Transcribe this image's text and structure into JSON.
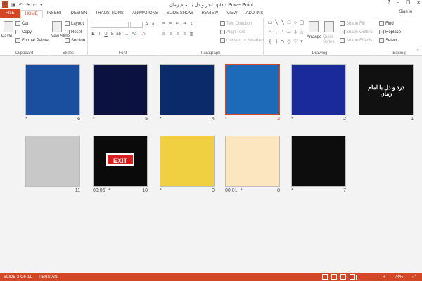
{
  "titlebar": {
    "title": "اندر و دل با امام زمان.pptx - PowerPoint",
    "app_logo": "P",
    "window_buttons": [
      "?",
      "–",
      "❐",
      "✕"
    ]
  },
  "tabs": [
    "FILE",
    "HOME",
    "INSERT",
    "DESIGN",
    "TRANSITIONS",
    "ANIMATIONS",
    "SLIDE SHOW",
    "REVIEW",
    "VIEW",
    "ADD-INS"
  ],
  "active_tab": "HOME",
  "signin": "Sign in",
  "ribbon": {
    "clipboard": {
      "label": "Clipboard",
      "paste": "Paste",
      "cut": "Cut",
      "copy": "Copy",
      "format_painter": "Format Painter"
    },
    "slides": {
      "label": "Slides",
      "new_slide": "New Slide",
      "layout": "Layout",
      "reset": "Reset",
      "section": "Section"
    },
    "font": {
      "label": "Font"
    },
    "paragraph": {
      "label": "Paragraph",
      "text_direction": "Text Direction",
      "align_text": "Align Text",
      "convert": "Convert to SmartArt"
    },
    "drawing": {
      "label": "Drawing",
      "arrange": "Arrange",
      "quick_styles": "Quick Styles",
      "shape_fill": "Shape Fill",
      "shape_outline": "Shape Outline",
      "shape_effects": "Shape Effects"
    },
    "editing": {
      "label": "Editing",
      "find": "Find",
      "replace": "Replace",
      "select": "Select"
    }
  },
  "slides": [
    {
      "num": "6",
      "timing": "",
      "star": "*",
      "bg": "#1a4fa0",
      "caption": "",
      "selected": false
    },
    {
      "num": "5",
      "timing": "",
      "star": "*",
      "bg": "#0c1240",
      "caption": "",
      "selected": false
    },
    {
      "num": "4",
      "timing": "",
      "star": "*",
      "bg": "#0a2a6a",
      "caption": "",
      "selected": false
    },
    {
      "num": "3",
      "timing": "",
      "star": "*",
      "bg": "#1c6ab8",
      "caption": "",
      "selected": true
    },
    {
      "num": "2",
      "timing": "",
      "star": "*",
      "bg": "#1a2a9a",
      "caption": "",
      "selected": false
    },
    {
      "num": "1",
      "timing": "",
      "star": "",
      "bg": "#111111",
      "caption": "درد و دل با امام زمان",
      "selected": false
    },
    {
      "num": "11",
      "timing": "",
      "star": "",
      "bg": "#c8c8c8",
      "caption": "",
      "selected": false
    },
    {
      "num": "10",
      "timing": "00:06",
      "star": "*",
      "bg": "#0a0a0a",
      "caption": "EXIT",
      "selected": false
    },
    {
      "num": "9",
      "timing": "",
      "star": "*",
      "bg": "#f0d040",
      "caption": "",
      "selected": false
    },
    {
      "num": "8",
      "timing": "00:01",
      "star": "*",
      "bg": "#fbe6c0",
      "caption": "",
      "selected": false
    },
    {
      "num": "7",
      "timing": "",
      "star": "*",
      "bg": "#0d0d0d",
      "caption": "",
      "selected": false
    }
  ],
  "statusbar": {
    "slide_info": "SLIDE 3 OF 11",
    "language": "PERSIAN",
    "zoom": "74%"
  },
  "colors": {
    "accent": "#d24726",
    "selection": "#d24726"
  }
}
